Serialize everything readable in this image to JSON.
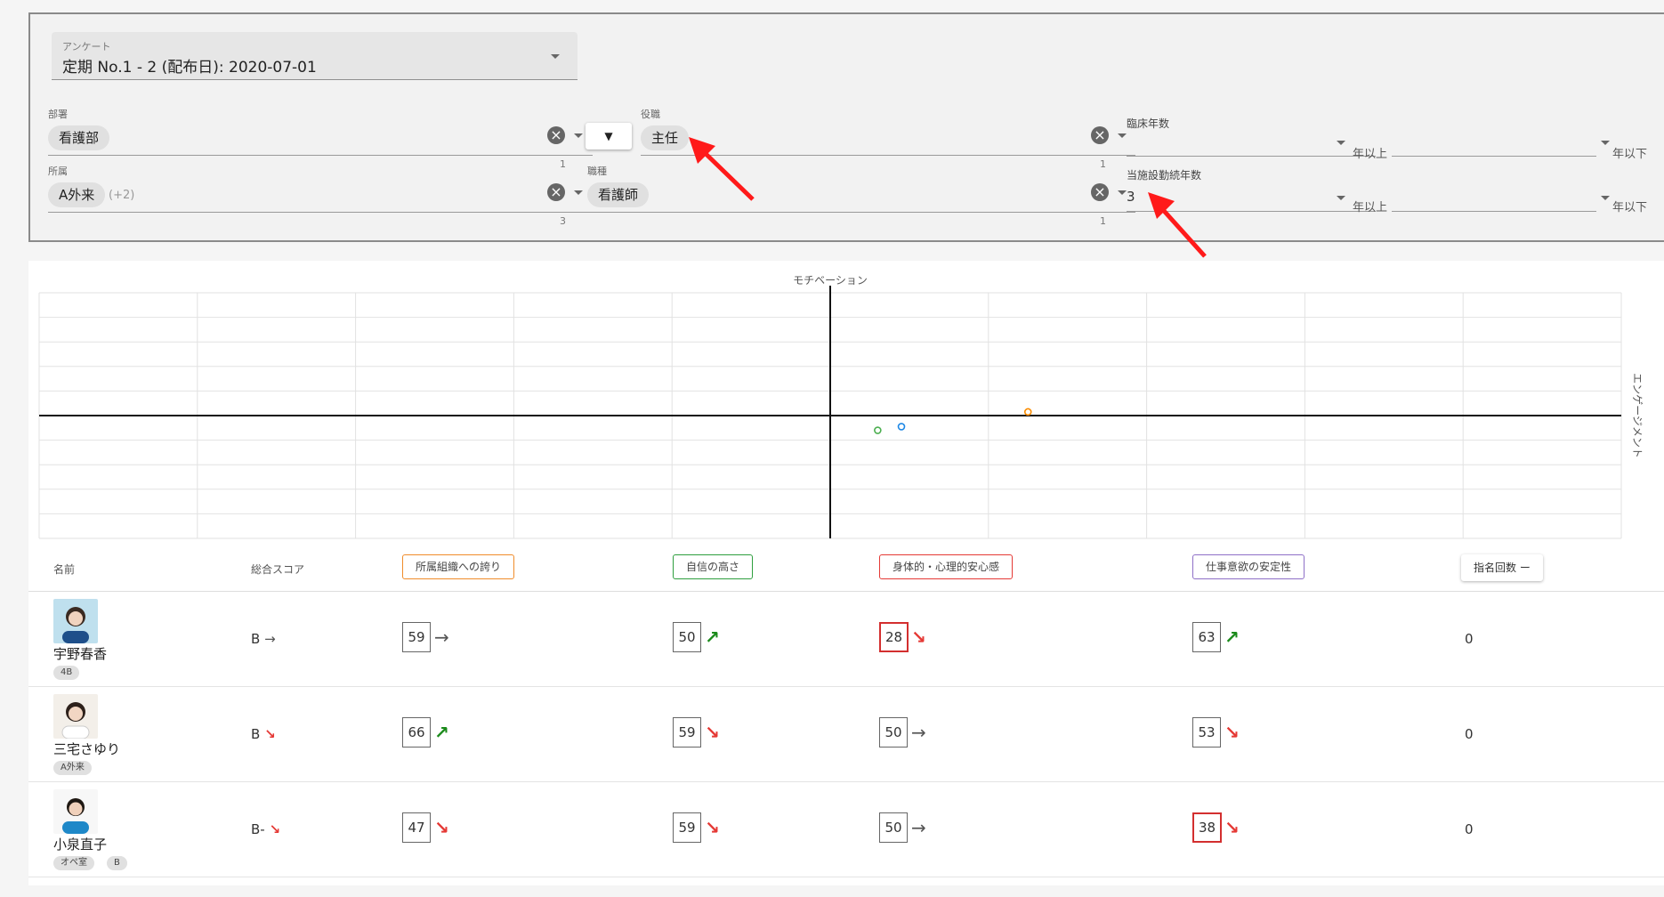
{
  "filters": {
    "survey": {
      "label": "アンケート",
      "value": "定期 No.1 - 2 (配布日): 2020-07-01"
    },
    "department": {
      "label": "部署",
      "chips": [
        "看護部"
      ],
      "counter": "1"
    },
    "affiliation": {
      "label": "所属",
      "chips": [
        "A外来"
      ],
      "more": "(+2)",
      "counter": "3"
    },
    "scope_toggle": {
      "label": "▼"
    },
    "position": {
      "label": "役職",
      "chips": [
        "主任"
      ],
      "counter": "1"
    },
    "occupation": {
      "label": "職種",
      "chips": [
        "看護師"
      ],
      "counter": "1"
    },
    "clinical_years": {
      "label": "臨床年数",
      "min_value": "",
      "max_value": "",
      "min_suffix": "年以上",
      "max_suffix": "年以下"
    },
    "tenure_years": {
      "label": "当施設勤続年数",
      "min_value": "3",
      "max_value": "",
      "min_suffix": "年以上",
      "max_suffix": "年以下"
    }
  },
  "chart_data": {
    "type": "scatter",
    "title": "",
    "xlabel": "",
    "ylabel": "",
    "top_axis_label": "モチベーション",
    "right_axis_label": "エンゲージメント",
    "xlim": [
      -5,
      5
    ],
    "ylim": [
      -5,
      5
    ],
    "grid": true,
    "points": [
      {
        "x": 0.3,
        "y": -0.6,
        "color": "#4caf50"
      },
      {
        "x": 0.45,
        "y": -0.45,
        "color": "#1e88e5"
      },
      {
        "x": 1.25,
        "y": 0.15,
        "color": "#fb8c00"
      }
    ]
  },
  "table": {
    "headers": {
      "name": "名前",
      "overall": "総合スコア",
      "cat1": "所属組織への誇り",
      "cat2": "自信の高さ",
      "cat3": "身体的・心理的安心感",
      "cat4": "仕事意欲の安定性",
      "nominations": "指名回数 ー"
    },
    "category_colors": {
      "cat1": "#f08c2a",
      "cat2": "#2e9e3e",
      "cat3": "#e53935",
      "cat4": "#8e6fc7"
    },
    "rows": [
      {
        "name": "宇野春香",
        "tags": [
          "4B"
        ],
        "overall": "B",
        "overall_trend": "→",
        "scores": [
          {
            "value": "59",
            "trend": "→",
            "low": false
          },
          {
            "value": "50",
            "trend": "↗",
            "low": false
          },
          {
            "value": "28",
            "trend": "↘",
            "low": true
          },
          {
            "value": "63",
            "trend": "↗",
            "low": false
          }
        ],
        "nominations": "0"
      },
      {
        "name": "三宅さゆり",
        "tags": [
          "A外来"
        ],
        "overall": "B",
        "overall_trend": "↘",
        "scores": [
          {
            "value": "66",
            "trend": "↗",
            "low": false
          },
          {
            "value": "59",
            "trend": "↘",
            "low": false
          },
          {
            "value": "50",
            "trend": "→",
            "low": false
          },
          {
            "value": "53",
            "trend": "↘",
            "low": false
          }
        ],
        "nominations": "0"
      },
      {
        "name": "小泉直子",
        "tags": [
          "オペ室",
          "B"
        ],
        "overall": "B-",
        "overall_trend": "↘",
        "scores": [
          {
            "value": "47",
            "trend": "↘",
            "low": false
          },
          {
            "value": "59",
            "trend": "↘",
            "low": false
          },
          {
            "value": "50",
            "trend": "→",
            "low": false
          },
          {
            "value": "38",
            "trend": "↘",
            "low": true
          }
        ],
        "nominations": "0"
      }
    ]
  }
}
